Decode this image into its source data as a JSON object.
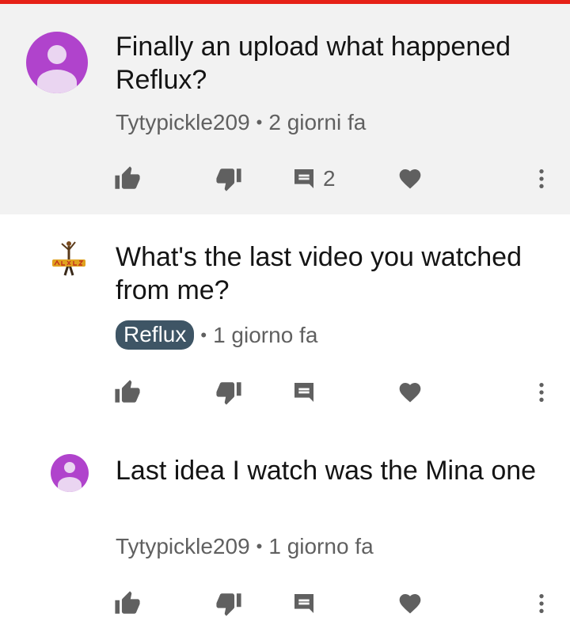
{
  "colors": {
    "accent_bar": "#e62117",
    "avatar_purple": "#b043cc",
    "author_badge_bg": "#3e5565",
    "icon_gray": "#606060",
    "highlight_bg": "#f2f2f2"
  },
  "comments": [
    {
      "text": "Finally an upload what happened Reflux?",
      "author": "Tytypickle209",
      "separator": "•",
      "time": "2 giorni fa",
      "reply_count": "2",
      "highlighted": true,
      "avatar_icon": "default-user-avatar-icon"
    },
    {
      "text": "What's the last video you watched from me?",
      "author": "Reflux",
      "separator": "•",
      "time": "1 giorno fa",
      "reply_count": "",
      "is_channel_owner": true,
      "avatar_icon": "reflux-channel-logo-icon"
    },
    {
      "text": "Last idea I watch was the Mina one",
      "author": "Tytypickle209",
      "separator": "•",
      "time": "1 giorno fa",
      "reply_count": "",
      "avatar_icon": "default-user-avatar-icon"
    }
  ],
  "action_icons": [
    "like-icon",
    "dislike-icon",
    "reply-icon",
    "heart-icon",
    "more-options-icon"
  ]
}
